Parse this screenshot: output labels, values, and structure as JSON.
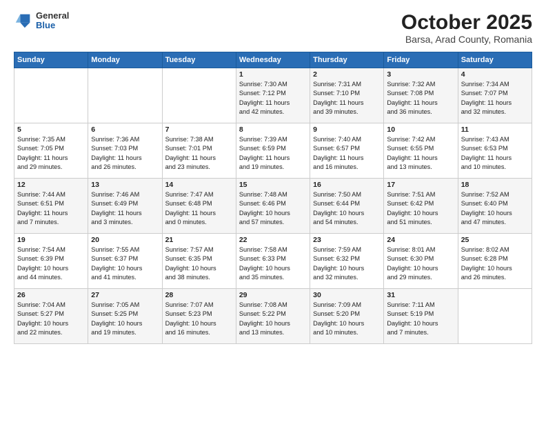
{
  "header": {
    "logo_general": "General",
    "logo_blue": "Blue",
    "title": "October 2025",
    "location": "Barsa, Arad County, Romania"
  },
  "days_of_week": [
    "Sunday",
    "Monday",
    "Tuesday",
    "Wednesday",
    "Thursday",
    "Friday",
    "Saturday"
  ],
  "weeks": [
    {
      "days": [
        {
          "number": "",
          "info": ""
        },
        {
          "number": "",
          "info": ""
        },
        {
          "number": "",
          "info": ""
        },
        {
          "number": "1",
          "info": "Sunrise: 7:30 AM\nSunset: 7:12 PM\nDaylight: 11 hours\nand 42 minutes."
        },
        {
          "number": "2",
          "info": "Sunrise: 7:31 AM\nSunset: 7:10 PM\nDaylight: 11 hours\nand 39 minutes."
        },
        {
          "number": "3",
          "info": "Sunrise: 7:32 AM\nSunset: 7:08 PM\nDaylight: 11 hours\nand 36 minutes."
        },
        {
          "number": "4",
          "info": "Sunrise: 7:34 AM\nSunset: 7:07 PM\nDaylight: 11 hours\nand 32 minutes."
        }
      ]
    },
    {
      "days": [
        {
          "number": "5",
          "info": "Sunrise: 7:35 AM\nSunset: 7:05 PM\nDaylight: 11 hours\nand 29 minutes."
        },
        {
          "number": "6",
          "info": "Sunrise: 7:36 AM\nSunset: 7:03 PM\nDaylight: 11 hours\nand 26 minutes."
        },
        {
          "number": "7",
          "info": "Sunrise: 7:38 AM\nSunset: 7:01 PM\nDaylight: 11 hours\nand 23 minutes."
        },
        {
          "number": "8",
          "info": "Sunrise: 7:39 AM\nSunset: 6:59 PM\nDaylight: 11 hours\nand 19 minutes."
        },
        {
          "number": "9",
          "info": "Sunrise: 7:40 AM\nSunset: 6:57 PM\nDaylight: 11 hours\nand 16 minutes."
        },
        {
          "number": "10",
          "info": "Sunrise: 7:42 AM\nSunset: 6:55 PM\nDaylight: 11 hours\nand 13 minutes."
        },
        {
          "number": "11",
          "info": "Sunrise: 7:43 AM\nSunset: 6:53 PM\nDaylight: 11 hours\nand 10 minutes."
        }
      ]
    },
    {
      "days": [
        {
          "number": "12",
          "info": "Sunrise: 7:44 AM\nSunset: 6:51 PM\nDaylight: 11 hours\nand 7 minutes."
        },
        {
          "number": "13",
          "info": "Sunrise: 7:46 AM\nSunset: 6:49 PM\nDaylight: 11 hours\nand 3 minutes."
        },
        {
          "number": "14",
          "info": "Sunrise: 7:47 AM\nSunset: 6:48 PM\nDaylight: 11 hours\nand 0 minutes."
        },
        {
          "number": "15",
          "info": "Sunrise: 7:48 AM\nSunset: 6:46 PM\nDaylight: 10 hours\nand 57 minutes."
        },
        {
          "number": "16",
          "info": "Sunrise: 7:50 AM\nSunset: 6:44 PM\nDaylight: 10 hours\nand 54 minutes."
        },
        {
          "number": "17",
          "info": "Sunrise: 7:51 AM\nSunset: 6:42 PM\nDaylight: 10 hours\nand 51 minutes."
        },
        {
          "number": "18",
          "info": "Sunrise: 7:52 AM\nSunset: 6:40 PM\nDaylight: 10 hours\nand 47 minutes."
        }
      ]
    },
    {
      "days": [
        {
          "number": "19",
          "info": "Sunrise: 7:54 AM\nSunset: 6:39 PM\nDaylight: 10 hours\nand 44 minutes."
        },
        {
          "number": "20",
          "info": "Sunrise: 7:55 AM\nSunset: 6:37 PM\nDaylight: 10 hours\nand 41 minutes."
        },
        {
          "number": "21",
          "info": "Sunrise: 7:57 AM\nSunset: 6:35 PM\nDaylight: 10 hours\nand 38 minutes."
        },
        {
          "number": "22",
          "info": "Sunrise: 7:58 AM\nSunset: 6:33 PM\nDaylight: 10 hours\nand 35 minutes."
        },
        {
          "number": "23",
          "info": "Sunrise: 7:59 AM\nSunset: 6:32 PM\nDaylight: 10 hours\nand 32 minutes."
        },
        {
          "number": "24",
          "info": "Sunrise: 8:01 AM\nSunset: 6:30 PM\nDaylight: 10 hours\nand 29 minutes."
        },
        {
          "number": "25",
          "info": "Sunrise: 8:02 AM\nSunset: 6:28 PM\nDaylight: 10 hours\nand 26 minutes."
        }
      ]
    },
    {
      "days": [
        {
          "number": "26",
          "info": "Sunrise: 7:04 AM\nSunset: 5:27 PM\nDaylight: 10 hours\nand 22 minutes."
        },
        {
          "number": "27",
          "info": "Sunrise: 7:05 AM\nSunset: 5:25 PM\nDaylight: 10 hours\nand 19 minutes."
        },
        {
          "number": "28",
          "info": "Sunrise: 7:07 AM\nSunset: 5:23 PM\nDaylight: 10 hours\nand 16 minutes."
        },
        {
          "number": "29",
          "info": "Sunrise: 7:08 AM\nSunset: 5:22 PM\nDaylight: 10 hours\nand 13 minutes."
        },
        {
          "number": "30",
          "info": "Sunrise: 7:09 AM\nSunset: 5:20 PM\nDaylight: 10 hours\nand 10 minutes."
        },
        {
          "number": "31",
          "info": "Sunrise: 7:11 AM\nSunset: 5:19 PM\nDaylight: 10 hours\nand 7 minutes."
        },
        {
          "number": "",
          "info": ""
        }
      ]
    }
  ]
}
